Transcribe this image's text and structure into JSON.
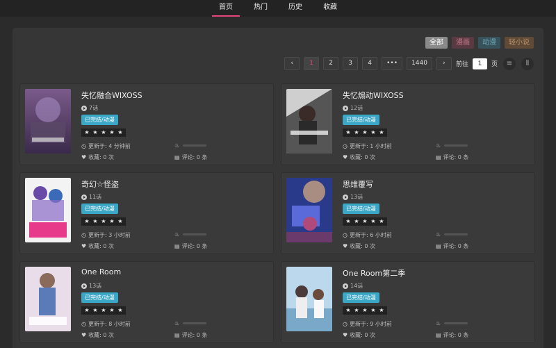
{
  "nav": [
    {
      "label": "首页",
      "active": true
    },
    {
      "label": "热门",
      "active": false
    },
    {
      "label": "历史",
      "active": false
    },
    {
      "label": "收藏",
      "active": false
    }
  ],
  "filters": {
    "all": "全部",
    "manga": "漫画",
    "anime": "动漫",
    "novel": "轻小说"
  },
  "pager": {
    "prev": "‹",
    "next": "›",
    "pages": [
      "1",
      "2",
      "3",
      "4"
    ],
    "ellipsis": "•••",
    "last": "1440",
    "goto_prefix": "前往",
    "goto_value": "1",
    "goto_suffix": "页",
    "list_view_icon": "≡",
    "grid_view_icon": "⦀"
  },
  "cards": [
    {
      "title": "失忆融合WIXOSS",
      "eps": "7话",
      "tag": "已完结/动漫",
      "updated": "更新于: 4 分钟前",
      "fav": "收藏: 0 次",
      "comments": "评论: 0 条",
      "rating": 5,
      "heat": 0
    },
    {
      "title": "失忆煽动WIXOSS",
      "eps": "12话",
      "tag": "已完结/动漫",
      "updated": "更新于: 1 小时前",
      "fav": "收藏: 0 次",
      "comments": "评论: 0 条",
      "rating": 5,
      "heat": 0
    },
    {
      "title": "奇幻☆怪盗",
      "eps": "11话",
      "tag": "已完结/动漫",
      "updated": "更新于: 3 小时前",
      "fav": "收藏: 0 次",
      "comments": "评论: 0 条",
      "rating": 5,
      "heat": 0
    },
    {
      "title": "思维覆写",
      "eps": "13话",
      "tag": "已完结/动漫",
      "updated": "更新于: 6 小时前",
      "fav": "收藏: 0 次",
      "comments": "评论: 0 条",
      "rating": 5,
      "heat": 0
    },
    {
      "title": "One Room",
      "eps": "13话",
      "tag": "已完结/动漫",
      "updated": "更新于: 8 小时前",
      "fav": "收藏: 0 次",
      "comments": "评论: 0 条",
      "rating": 5,
      "heat": 0
    },
    {
      "title": "One Room第二季",
      "eps": "14话",
      "tag": "已完结/动漫",
      "updated": "更新于: 9 小时前",
      "fav": "收藏: 0 次",
      "comments": "评论: 0 条",
      "rating": 5,
      "heat": 0
    }
  ],
  "colors": {
    "accent": "#e3467a",
    "tag": "#3ba7c6",
    "panel": "#363636",
    "card": "#3a3a3a"
  }
}
